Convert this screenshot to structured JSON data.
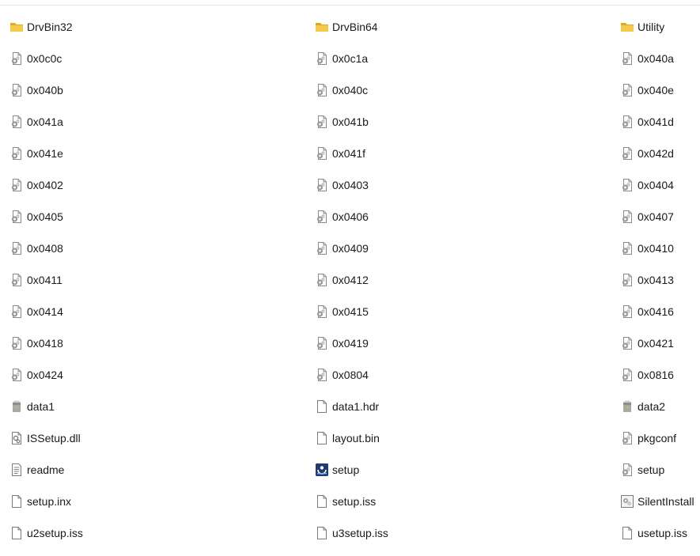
{
  "explorer": {
    "items": [
      {
        "name": "DrvBin32",
        "icon": "folder-icon"
      },
      {
        "name": "DrvBin64",
        "icon": "folder-icon"
      },
      {
        "name": "Utility",
        "icon": "folder-icon"
      },
      {
        "name": "0x0c0c",
        "icon": "settings-file-icon"
      },
      {
        "name": "0x0c1a",
        "icon": "settings-file-icon"
      },
      {
        "name": "0x040a",
        "icon": "settings-file-icon"
      },
      {
        "name": "0x040b",
        "icon": "settings-file-icon"
      },
      {
        "name": "0x040c",
        "icon": "settings-file-icon"
      },
      {
        "name": "0x040e",
        "icon": "settings-file-icon"
      },
      {
        "name": "0x041a",
        "icon": "settings-file-icon"
      },
      {
        "name": "0x041b",
        "icon": "settings-file-icon"
      },
      {
        "name": "0x041d",
        "icon": "settings-file-icon"
      },
      {
        "name": "0x041e",
        "icon": "settings-file-icon"
      },
      {
        "name": "0x041f",
        "icon": "settings-file-icon"
      },
      {
        "name": "0x042d",
        "icon": "settings-file-icon"
      },
      {
        "name": "0x0402",
        "icon": "settings-file-icon"
      },
      {
        "name": "0x0403",
        "icon": "settings-file-icon"
      },
      {
        "name": "0x0404",
        "icon": "settings-file-icon"
      },
      {
        "name": "0x0405",
        "icon": "settings-file-icon"
      },
      {
        "name": "0x0406",
        "icon": "settings-file-icon"
      },
      {
        "name": "0x0407",
        "icon": "settings-file-icon"
      },
      {
        "name": "0x0408",
        "icon": "settings-file-icon"
      },
      {
        "name": "0x0409",
        "icon": "settings-file-icon"
      },
      {
        "name": "0x0410",
        "icon": "settings-file-icon"
      },
      {
        "name": "0x0411",
        "icon": "settings-file-icon"
      },
      {
        "name": "0x0412",
        "icon": "settings-file-icon"
      },
      {
        "name": "0x0413",
        "icon": "settings-file-icon"
      },
      {
        "name": "0x0414",
        "icon": "settings-file-icon"
      },
      {
        "name": "0x0415",
        "icon": "settings-file-icon"
      },
      {
        "name": "0x0416",
        "icon": "settings-file-icon"
      },
      {
        "name": "0x0418",
        "icon": "settings-file-icon"
      },
      {
        "name": "0x0419",
        "icon": "settings-file-icon"
      },
      {
        "name": "0x0421",
        "icon": "settings-file-icon"
      },
      {
        "name": "0x0424",
        "icon": "settings-file-icon"
      },
      {
        "name": "0x0804",
        "icon": "settings-file-icon"
      },
      {
        "name": "0x0816",
        "icon": "settings-file-icon"
      },
      {
        "name": "data1",
        "icon": "cabinet-archive-icon"
      },
      {
        "name": "data1.hdr",
        "icon": "blank-file-icon"
      },
      {
        "name": "data2",
        "icon": "cabinet-archive-icon"
      },
      {
        "name": "ISSetup.dll",
        "icon": "dll-file-icon"
      },
      {
        "name": "layout.bin",
        "icon": "blank-file-icon"
      },
      {
        "name": "pkgconf",
        "icon": "settings-file-icon"
      },
      {
        "name": "readme",
        "icon": "text-file-icon"
      },
      {
        "name": "setup",
        "icon": "installer-app-icon"
      },
      {
        "name": "setup",
        "icon": "settings-file-icon"
      },
      {
        "name": "setup.inx",
        "icon": "blank-file-icon"
      },
      {
        "name": "setup.iss",
        "icon": "blank-file-icon"
      },
      {
        "name": "SilentInstall",
        "icon": "shortcut-app-icon"
      },
      {
        "name": "u2setup.iss",
        "icon": "blank-file-icon"
      },
      {
        "name": "u3setup.iss",
        "icon": "blank-file-icon"
      },
      {
        "name": "usetup.iss",
        "icon": "blank-file-icon"
      }
    ]
  },
  "colors": {
    "folder": "#f7c948",
    "folder_dark": "#e3a821",
    "text": "#1a1a1a",
    "file_outline": "#7a7a7a",
    "installer_bg": "#1e3a6e"
  }
}
